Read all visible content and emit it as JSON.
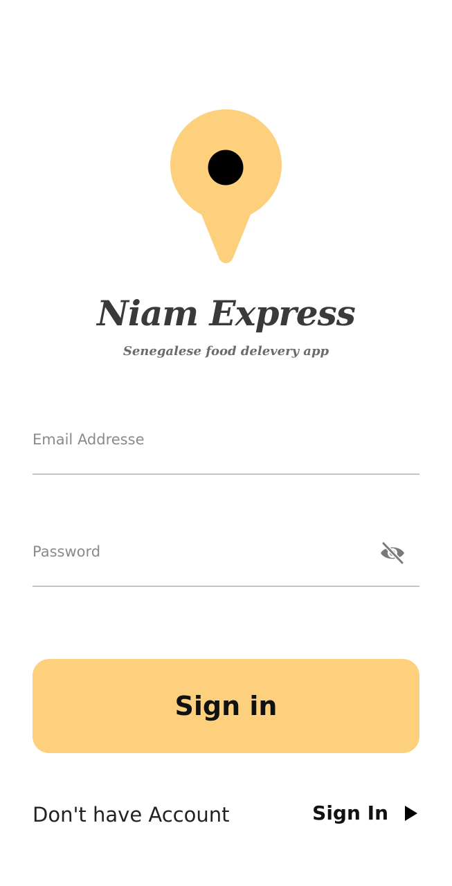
{
  "app": {
    "name": "Niam Express",
    "tagline": "Senegalese food delevery app",
    "logo_icon": "map-pin-icon",
    "accent_color": "#fdd07e"
  },
  "form": {
    "email": {
      "placeholder": "Email Addresse",
      "value": ""
    },
    "password": {
      "placeholder": "Password",
      "value": "",
      "toggle_icon": "eye-off-icon"
    },
    "submit_label": "Sign in"
  },
  "footer": {
    "prompt": "Don't have Account",
    "link_label": "Sign In",
    "link_icon": "play-arrow-icon"
  }
}
